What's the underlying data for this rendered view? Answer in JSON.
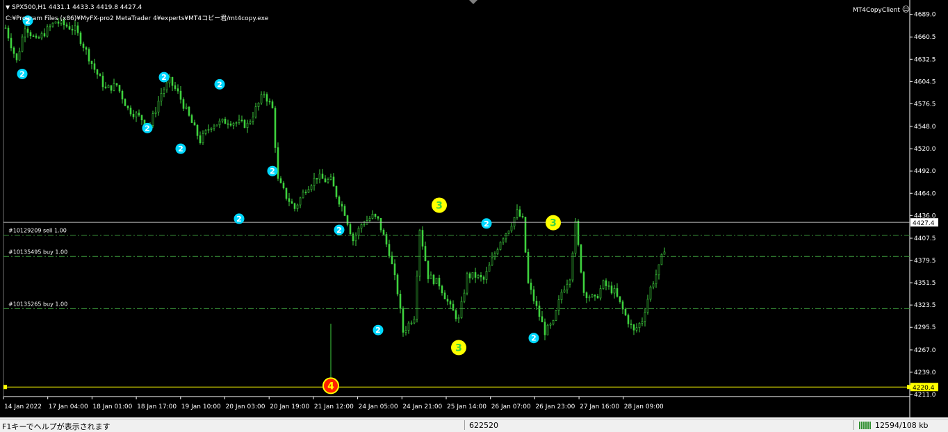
{
  "header": {
    "symbol_line": "SPX500,H1  4431.1 4433.3 4419.8 4427.4",
    "path_line": "C:¥Program Files (x86)¥MyFX-pro2 MetaTrader 4¥experts¥MT4コピー君/mt4copy.exe",
    "indicator_name": "MT4CopyClient"
  },
  "colors": {
    "background": "#000000",
    "candle": "#3fd23f",
    "axis": "#ffffff",
    "order_line": "#3c9a3c",
    "bid_line": "#c0c0c0",
    "low_line": "#ffff00",
    "marker_cyan": "#00d8ff",
    "marker_yellow": "#ffff00",
    "marker_red": "#ff2000"
  },
  "chart_data": {
    "type": "candlestick",
    "symbol": "SPX500",
    "timeframe": "H1",
    "ylim": [
      4211.0,
      4700.0
    ],
    "y_ticks": [
      "4689.0",
      "4660.5",
      "4632.5",
      "4604.5",
      "4576.5",
      "4548.0",
      "4520.0",
      "4492.0",
      "4464.0",
      "4436.0",
      "4407.5",
      "4379.5",
      "4351.5",
      "4323.5",
      "4295.5",
      "4267.0",
      "4239.0",
      "4211.0"
    ],
    "x_ticks": [
      "14 Jan 2022",
      "17 Jan 04:00",
      "18 Jan 01:00",
      "18 Jan 17:00",
      "19 Jan 10:00",
      "20 Jan 03:00",
      "20 Jan 19:00",
      "21 Jan 12:00",
      "24 Jan 05:00",
      "24 Jan 21:00",
      "25 Jan 14:00",
      "26 Jan 07:00",
      "26 Jan 23:00",
      "27 Jan 16:00",
      "28 Jan 09:00"
    ],
    "price_path": [
      [
        0,
        4672
      ],
      [
        4,
        4630
      ],
      [
        7,
        4675
      ],
      [
        11,
        4655
      ],
      [
        18,
        4680
      ],
      [
        25,
        4670
      ],
      [
        28,
        4650
      ],
      [
        32,
        4620
      ],
      [
        36,
        4595
      ],
      [
        40,
        4600
      ],
      [
        44,
        4570
      ],
      [
        48,
        4560
      ],
      [
        52,
        4550
      ],
      [
        56,
        4590
      ],
      [
        59,
        4605
      ],
      [
        62,
        4590
      ],
      [
        66,
        4560
      ],
      [
        70,
        4530
      ],
      [
        74,
        4550
      ],
      [
        80,
        4555
      ],
      [
        87,
        4550
      ],
      [
        93,
        4590
      ],
      [
        96,
        4570
      ],
      [
        98,
        4480
      ],
      [
        101,
        4460
      ],
      [
        104,
        4445
      ],
      [
        108,
        4470
      ],
      [
        112,
        4485
      ],
      [
        115,
        4480
      ],
      [
        117,
        4480
      ],
      [
        119,
        4462
      ],
      [
        122,
        4440
      ],
      [
        125,
        4405
      ],
      [
        128,
        4425
      ],
      [
        132,
        4435
      ],
      [
        134,
        4430
      ],
      [
        138,
        4390
      ],
      [
        141,
        4340
      ],
      [
        143,
        4290
      ],
      [
        145,
        4300
      ],
      [
        147,
        4310
      ],
      [
        149,
        4420
      ],
      [
        152,
        4360
      ],
      [
        156,
        4350
      ],
      [
        160,
        4320
      ],
      [
        163,
        4305
      ],
      [
        166,
        4360
      ],
      [
        169,
        4360
      ],
      [
        172,
        4355
      ],
      [
        175,
        4380
      ],
      [
        178,
        4405
      ],
      [
        181,
        4420
      ],
      [
        184,
        4440
      ],
      [
        186,
        4430
      ],
      [
        188,
        4350
      ],
      [
        191,
        4320
      ],
      [
        194,
        4290
      ],
      [
        197,
        4300
      ],
      [
        200,
        4340
      ],
      [
        203,
        4360
      ],
      [
        205,
        4425
      ],
      [
        208,
        4340
      ],
      [
        212,
        4330
      ],
      [
        215,
        4350
      ],
      [
        219,
        4340
      ],
      [
        223,
        4310
      ],
      [
        226,
        4290
      ],
      [
        229,
        4305
      ],
      [
        232,
        4345
      ],
      [
        235,
        4370
      ],
      [
        237,
        4395
      ]
    ],
    "bid": 4427.4,
    "bid_label": "4427.4",
    "period_low": 4220.4,
    "period_low_label": "4220.4",
    "orders": [
      {
        "label": "#10129209 sell 1.00",
        "price": 4411.2
      },
      {
        "label": "#10135495 buy 1.00",
        "price": 4384.5
      },
      {
        "label": "#10135265 buy 1.00",
        "price": 4319.0
      }
    ],
    "markers": [
      {
        "bar": 8,
        "price": 4681,
        "text": "2",
        "color": "cyan"
      },
      {
        "bar": 6,
        "price": 4614,
        "text": "2",
        "color": "cyan"
      },
      {
        "bar": 51,
        "price": 4546,
        "text": "2",
        "color": "cyan"
      },
      {
        "bar": 57,
        "price": 4610,
        "text": "2",
        "color": "cyan"
      },
      {
        "bar": 63,
        "price": 4520,
        "text": "2",
        "color": "cyan"
      },
      {
        "bar": 77,
        "price": 4601,
        "text": "2",
        "color": "cyan"
      },
      {
        "bar": 84,
        "price": 4432,
        "text": "2",
        "color": "cyan"
      },
      {
        "bar": 96,
        "price": 4492,
        "text": "2",
        "color": "cyan"
      },
      {
        "bar": 120,
        "price": 4418,
        "text": "2",
        "color": "cyan"
      },
      {
        "bar": 134,
        "price": 4292,
        "text": "2",
        "color": "cyan"
      },
      {
        "bar": 156,
        "price": 4449,
        "text": "3",
        "color": "yellow"
      },
      {
        "bar": 163,
        "price": 4270,
        "text": "3",
        "color": "yellow"
      },
      {
        "bar": 173,
        "price": 4426,
        "text": "2",
        "color": "cyan"
      },
      {
        "bar": 190,
        "price": 4282,
        "text": "2",
        "color": "cyan"
      },
      {
        "bar": 197,
        "price": 4427,
        "text": "3",
        "color": "yellow"
      },
      {
        "bar": 117,
        "price": 4222,
        "text": "4",
        "color": "red"
      }
    ]
  },
  "status_bar": {
    "help_text": "F1キーでヘルプが表示されます",
    "profile": "622520",
    "traffic": "12594/108 kb"
  }
}
